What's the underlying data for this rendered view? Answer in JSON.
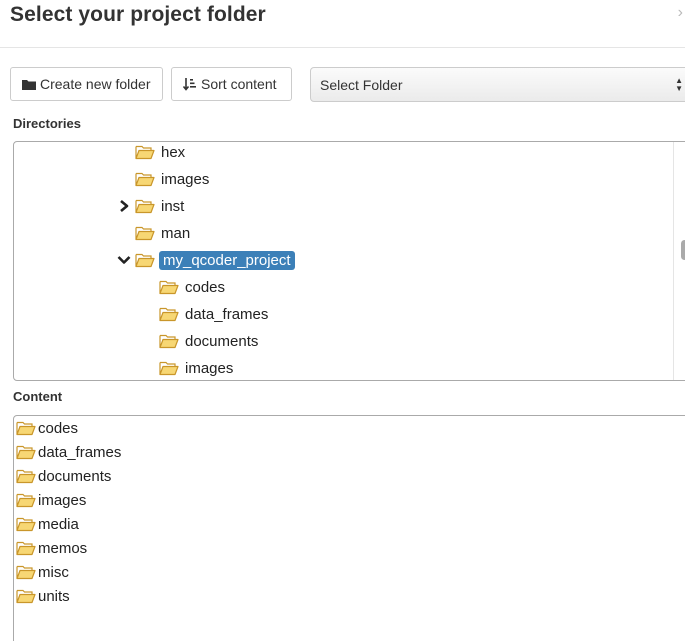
{
  "dialog": {
    "title": "Select your project folder",
    "close_glyph": "›"
  },
  "toolbar": {
    "create_label": "Create new folder",
    "sort_label": "Sort content",
    "select_value": "Select Folder"
  },
  "sections": {
    "directories_label": "Directories",
    "content_label": "Content"
  },
  "directories": [
    {
      "label": "hex",
      "level": 0,
      "expander": "none",
      "selected": false
    },
    {
      "label": "images",
      "level": 0,
      "expander": "none",
      "selected": false
    },
    {
      "label": "inst",
      "level": 0,
      "expander": "collapsed",
      "selected": false
    },
    {
      "label": "man",
      "level": 0,
      "expander": "none",
      "selected": false
    },
    {
      "label": "my_qcoder_project",
      "level": 0,
      "expander": "expanded",
      "selected": true
    },
    {
      "label": "codes",
      "level": 1,
      "expander": "none",
      "selected": false
    },
    {
      "label": "data_frames",
      "level": 1,
      "expander": "none",
      "selected": false
    },
    {
      "label": "documents",
      "level": 1,
      "expander": "none",
      "selected": false
    },
    {
      "label": "images",
      "level": 1,
      "expander": "none",
      "selected": false
    }
  ],
  "content": [
    "codes",
    "data_frames",
    "documents",
    "images",
    "media",
    "memos",
    "misc",
    "units"
  ],
  "colors": {
    "selection": "#3c80b8",
    "folder_fill": "#f7d774",
    "folder_stroke": "#c9962a"
  },
  "icons": {
    "create": "folder-icon",
    "sort": "sort-icon",
    "tree_folder": "open-folder-icon",
    "expand": "chevron-right-icon",
    "collapse": "chevron-down-icon"
  }
}
